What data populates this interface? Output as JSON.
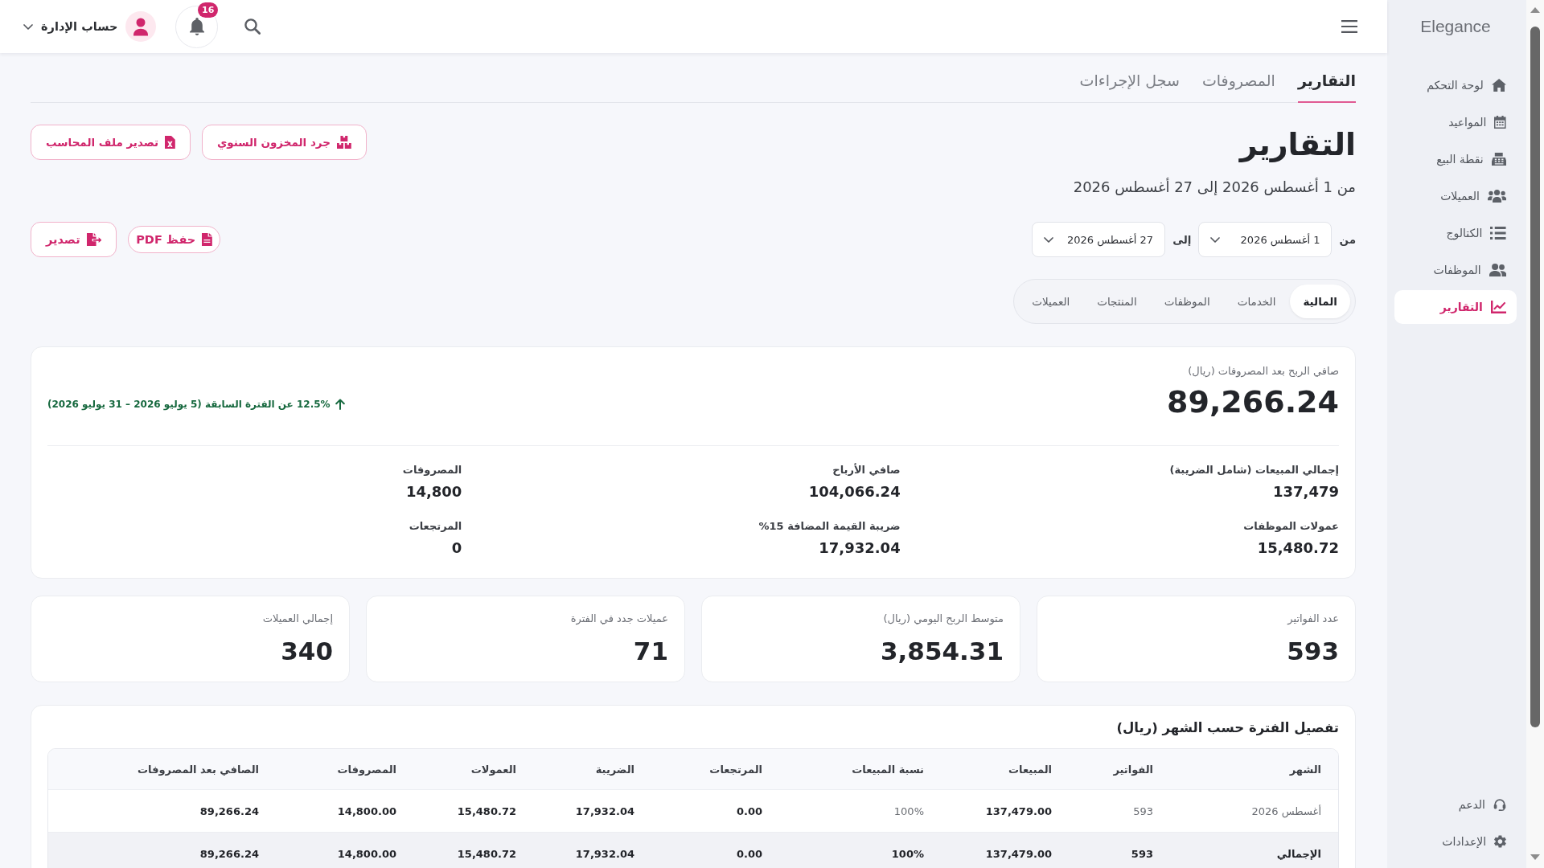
{
  "top_bar": {
    "account_name": "حساب الإدارة",
    "notification_count": "16"
  },
  "sidebar": {
    "brand": "Elegance",
    "items": [
      {
        "label": "لوحة التحكم",
        "selected": false
      },
      {
        "label": "المواعيد",
        "selected": false
      },
      {
        "label": "نقطة البيع",
        "selected": false
      },
      {
        "label": "العميلات",
        "selected": false
      },
      {
        "label": "الكتالوج",
        "selected": false
      },
      {
        "label": "الموظفات",
        "selected": false
      },
      {
        "label": "التقارير",
        "selected": true
      }
    ],
    "footer_items": [
      {
        "label": "الدعم",
        "selected": false
      },
      {
        "label": "الإعدادات",
        "selected": false
      }
    ]
  },
  "tabs": [
    {
      "label": "التقارير",
      "selected": true
    },
    {
      "label": "المصروفات",
      "selected": false
    },
    {
      "label": "سجل الإجراءات",
      "selected": false
    }
  ],
  "header": {
    "title": "التقارير",
    "subtitle": "من 1 أغسطس 2026 إلى 27 أغسطس 2026",
    "buttons": [
      "جرد المخزون السنوي",
      "تصدير ملف المحاسب"
    ]
  },
  "date_range": {
    "from_label": "من",
    "from_value": "1 أغسطس 2026",
    "to_label": "إلى",
    "to_value": "27 أغسطس 2026",
    "buttons": [
      "حفظ PDF",
      "تصدير"
    ]
  },
  "report_tabs": [
    {
      "label": "المالية",
      "selected": true
    },
    {
      "label": "الخدمات",
      "selected": false
    },
    {
      "label": "الموظفات",
      "selected": false
    },
    {
      "label": "المنتجات",
      "selected": false
    },
    {
      "label": "العميلات",
      "selected": false
    }
  ],
  "summary": {
    "label": "صافي الربح بعد المصروفات (ريال)",
    "value": "89,266.24",
    "increase": true,
    "change": "12.5% عن الفترة السابقة (5 يوليو 2026 – 31 يوليو 2026)",
    "metrics": [
      {
        "label": "إجمالي المبيعات (شامل الضريبة)",
        "value": "137,479"
      },
      {
        "label": "صافي الأرباح",
        "value": "104,066.24"
      },
      {
        "label": "المصروفات",
        "value": "14,800"
      },
      {
        "label": "عمولات الموظفات",
        "value": "15,480.72"
      },
      {
        "label": "ضريبة القيمة المضافة 15%",
        "value": "17,932.04"
      },
      {
        "label": "المرتجعات",
        "value": "0"
      }
    ]
  },
  "stat_cards": [
    {
      "label": "عدد الفواتير",
      "value": "593"
    },
    {
      "label": "متوسط الربح اليومي (ريال)",
      "value": "3,854.31"
    },
    {
      "label": "عميلات جدد في الفترة",
      "value": "71"
    },
    {
      "label": "إجمالي العميلات",
      "value": "340"
    }
  ],
  "monthly_table": {
    "title": "تفصيل الفترة حسب الشهر (ريال)",
    "columns": [
      "الشهر",
      "الفواتير",
      "المبيعات",
      "نسبة المبيعات",
      "المرتجعات",
      "الضريبة",
      "العمولات",
      "المصروفات",
      "الصافي بعد المصروفات"
    ],
    "rows": [
      [
        "أغسطس 2026",
        "593",
        "137,479.00",
        "100%",
        "0.00",
        "17,932.04",
        "15,480.72",
        "14,800.00",
        "89,266.24"
      ]
    ],
    "total_row": [
      "الإجمالي",
      "593",
      "137,479.00",
      "100%",
      "0.00",
      "17,932.04",
      "15,480.72",
      "14,800.00",
      "89,266.24"
    ]
  }
}
